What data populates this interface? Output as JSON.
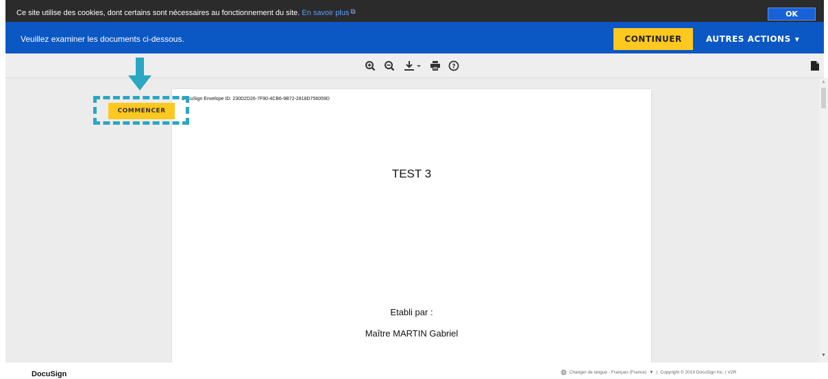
{
  "cookie_bar": {
    "text": "Ce site utilise des cookies, dont certains sont nécessaires au fonctionnement du site.",
    "link": "En savoir plus",
    "ok": "OK"
  },
  "review_bar": {
    "message": "Veuillez examiner les documents ci-dessous.",
    "continue": "CONTINUER",
    "other_actions": "AUTRES ACTIONS"
  },
  "toolbar": {
    "icons": [
      "zoom-in-icon",
      "zoom-out-icon",
      "download-icon",
      "print-icon",
      "help-icon",
      "document-icon"
    ]
  },
  "document": {
    "envelope_id": "DocuSign Envelope ID: 230D2D26-7F90-4CB6-9B72-2818D756059D",
    "title": "TEST 3",
    "established_by": "Etabli par :",
    "author": "Maître MARTIN Gabriel"
  },
  "start_button": "COMMENCER",
  "colors": {
    "brand_blue": "#0b57c4",
    "accent_yellow": "#ffc820",
    "highlight_teal": "#2aa7c2"
  },
  "footer": {
    "logo": "DocuSign",
    "language": "Changer de langue - Français (France)",
    "copyright": "Copyright © 2019 DocuSign Inc. | V2R"
  }
}
